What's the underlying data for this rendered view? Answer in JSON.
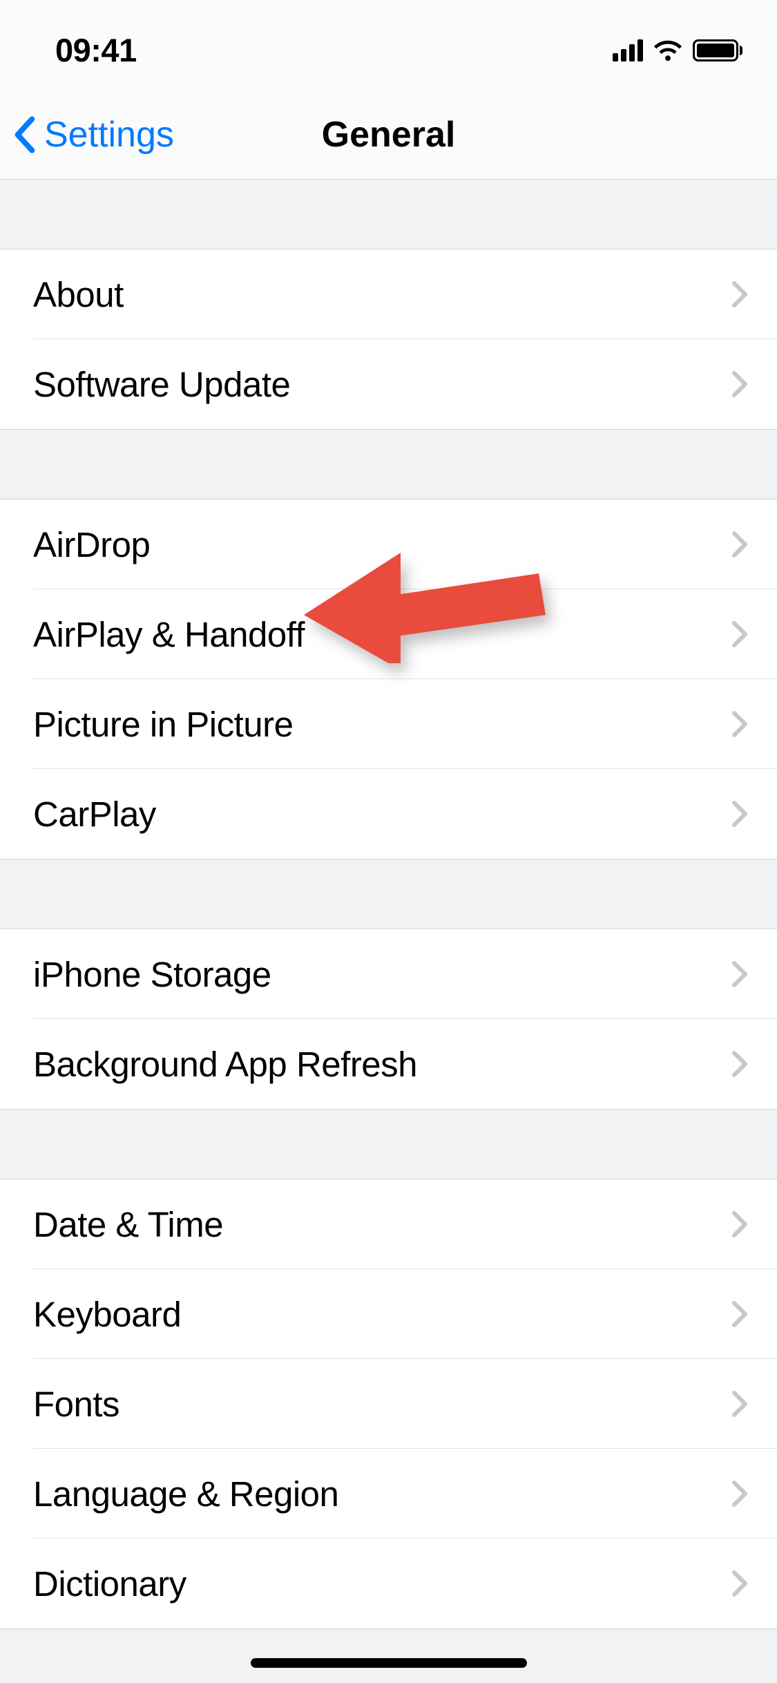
{
  "statusBar": {
    "time": "09:41"
  },
  "nav": {
    "back": "Settings",
    "title": "General"
  },
  "groups": [
    {
      "rows": [
        {
          "id": "about",
          "label": "About"
        },
        {
          "id": "software-update",
          "label": "Software Update"
        }
      ]
    },
    {
      "rows": [
        {
          "id": "airdrop",
          "label": "AirDrop"
        },
        {
          "id": "airplay-handoff",
          "label": "AirPlay & Handoff"
        },
        {
          "id": "pip",
          "label": "Picture in Picture"
        },
        {
          "id": "carplay",
          "label": "CarPlay"
        }
      ]
    },
    {
      "rows": [
        {
          "id": "iphone-storage",
          "label": "iPhone Storage"
        },
        {
          "id": "background-app-refresh",
          "label": "Background App Refresh"
        }
      ]
    },
    {
      "rows": [
        {
          "id": "date-time",
          "label": "Date & Time"
        },
        {
          "id": "keyboard",
          "label": "Keyboard"
        },
        {
          "id": "fonts",
          "label": "Fonts"
        },
        {
          "id": "language-region",
          "label": "Language & Region"
        },
        {
          "id": "dictionary",
          "label": "Dictionary"
        }
      ]
    }
  ],
  "annotation": {
    "color": "#e94c3c",
    "target": "airplay-handoff"
  }
}
